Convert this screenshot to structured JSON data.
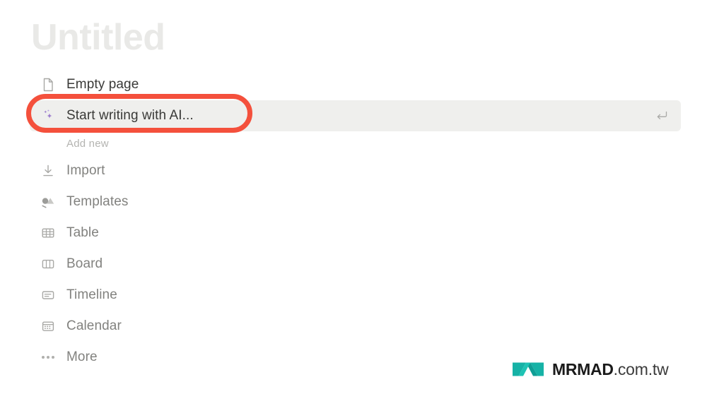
{
  "document": {
    "title_placeholder": "Untitled"
  },
  "menu": {
    "primary_items": [
      {
        "label": "Empty page",
        "icon": "document-icon",
        "shortcut": ""
      },
      {
        "label": "Start writing with AI...",
        "icon": "ai-sparkle-icon",
        "shortcut": "enter-key-icon"
      }
    ],
    "section_caption": "Add new",
    "add_new_items": [
      {
        "label": "Import",
        "icon": "import-download-icon"
      },
      {
        "label": "Templates",
        "icon": "templates-shapes-icon"
      },
      {
        "label": "Table",
        "icon": "table-grid-icon"
      },
      {
        "label": "Board",
        "icon": "board-columns-icon"
      },
      {
        "label": "Timeline",
        "icon": "timeline-icon"
      },
      {
        "label": "Calendar",
        "icon": "calendar-icon"
      },
      {
        "label": "More",
        "icon": "more-ellipsis-icon"
      }
    ]
  },
  "annotation": {
    "target_label": "Start writing with AI...",
    "ring_color": "#f4503c"
  },
  "watermark": {
    "brand": "MRMAD",
    "tld": ".com.tw",
    "mark_color": "#16b2a6"
  },
  "colors": {
    "background": "#ffffff",
    "highlight_row": "#efefed",
    "title_placeholder": "#e9e9e7",
    "label_text": "#82827f",
    "icon": "#a8a8a5",
    "ai_accent": "#9b7ccd"
  }
}
